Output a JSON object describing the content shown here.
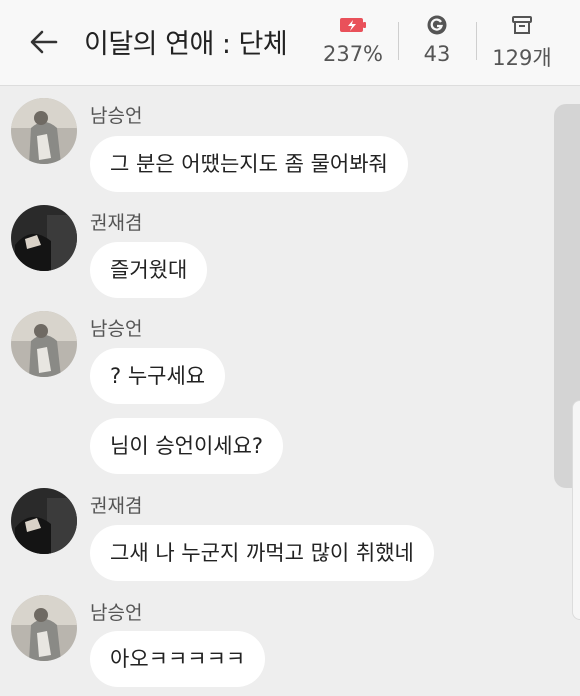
{
  "header": {
    "title": "이달의 연애 : 단체",
    "battery_value": "237%",
    "coin_value": "43",
    "box_value": "129개",
    "accent_color": "#e9515a"
  },
  "messages": [
    {
      "sender": "남승언",
      "text": "그 분은 어땠는지도 좀 물어봐줘"
    },
    {
      "sender": "권재겸",
      "text": "즐거웠대"
    },
    {
      "sender": "남승언",
      "text": "? 누구세요"
    },
    {
      "sender": "",
      "text": "님이 승언이세요?"
    },
    {
      "sender": "권재겸",
      "text": "그새 나 누군지 까먹고 많이 취했네"
    },
    {
      "sender": "남승언",
      "text": "아오ㅋㅋㅋㅋㅋ"
    }
  ]
}
